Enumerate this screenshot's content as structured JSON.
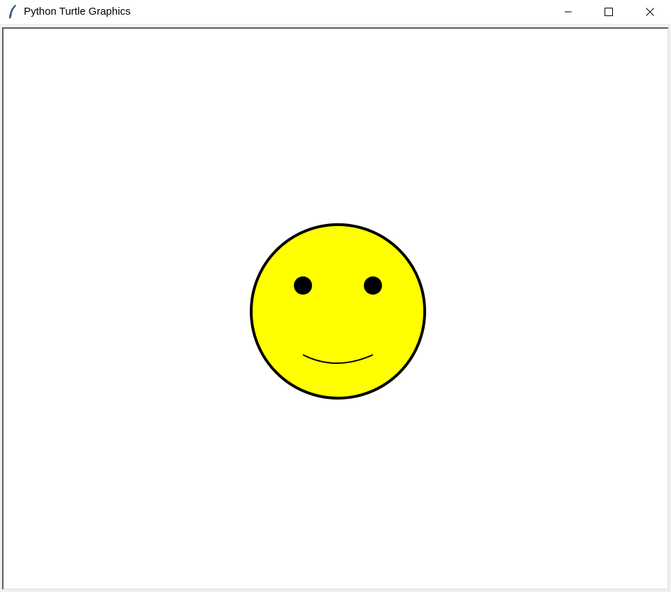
{
  "window": {
    "title": "Python Turtle Graphics",
    "app_icon": "feather-icon",
    "controls": {
      "minimize_icon": "minimize-icon",
      "maximize_icon": "maximize-icon",
      "close_icon": "close-icon"
    }
  },
  "drawing": {
    "background_color": "#ffffff",
    "face": {
      "fill_color": "#ffff00",
      "outline_color": "#000000"
    },
    "eyes": {
      "color": "#000000",
      "count": 2
    },
    "mouth": {
      "color": "#000000"
    }
  }
}
